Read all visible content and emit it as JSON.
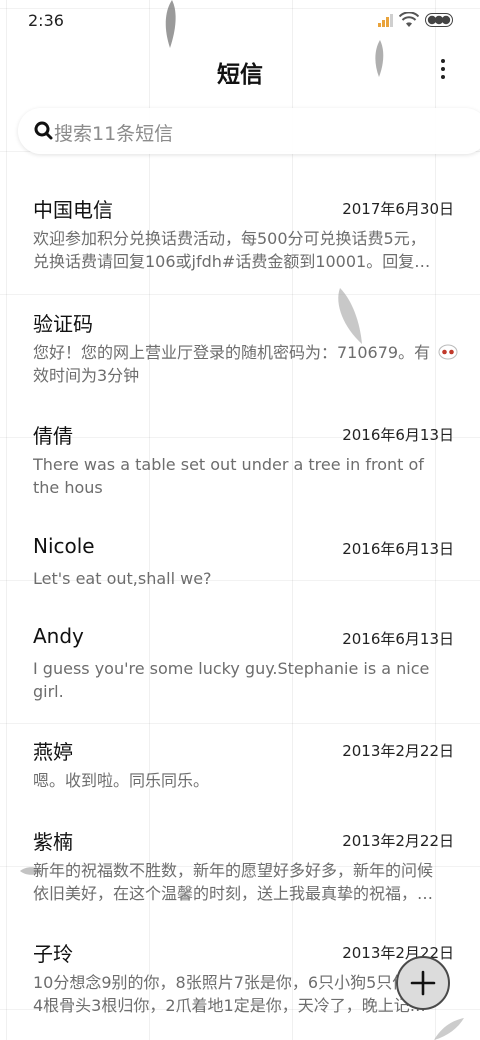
{
  "status_bar": {
    "time": "2:36",
    "signal_color": "#e9a33b"
  },
  "header": {
    "title": "短信",
    "menu_icon": "more-vertical-icon"
  },
  "search": {
    "icon": "search-icon",
    "placeholder": "搜索11条短信"
  },
  "messages": [
    {
      "sender": "中国电信",
      "date": "2017年6月30日",
      "preview": "欢迎参加积分兑换话费活动，每500分可兑换话费5元，兑换话费请回复106或jfdh#话费金额到10001。回复…"
    },
    {
      "sender": "验证码",
      "date": "",
      "preview": "您好！您的网上营业厅登录的随机密码为：710679。有效时间为3分钟"
    },
    {
      "sender": "倩倩",
      "date": "2016年6月13日",
      "preview": "There was a table set out under a tree in front of the hous"
    },
    {
      "sender": "Nicole",
      "date": "2016年6月13日",
      "preview": "Let's eat out,shall we?"
    },
    {
      "sender": "Andy",
      "date": "2016年6月13日",
      "preview": "I guess you're some lucky guy.Stephanie is a nice girl."
    },
    {
      "sender": "燕婷",
      "date": "2013年2月22日",
      "preview": "嗯。收到啦。同乐同乐。"
    },
    {
      "sender": "紫楠",
      "date": "2013年2月22日",
      "preview": "新年的祝福数不胜数，新年的愿望好多好多，新年的问候依旧美好，在这个温馨的时刻，送上我最真挚的祝福，…"
    },
    {
      "sender": "子玲",
      "date": "2013年2月22日",
      "preview": "10分想念9别的你，8张照片7张是你，6只小狗5只像你，4根骨头3根归你，2爪着地1定是你，天冷了，晚上记…"
    }
  ],
  "fab": {
    "icon": "plus-icon"
  }
}
